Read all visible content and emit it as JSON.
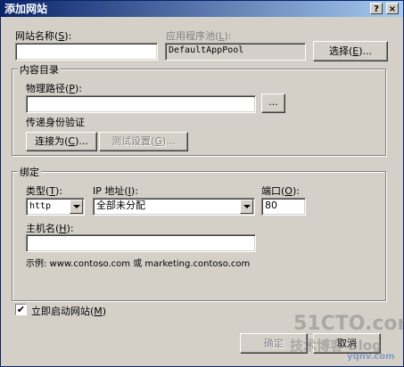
{
  "window": {
    "title": "添加网站",
    "help_label": "?",
    "close_label": "×"
  },
  "site_name": {
    "label": "网站名称",
    "accel": "S",
    "value": ""
  },
  "app_pool": {
    "label": "应用程序池",
    "accel": "L",
    "value": "DefaultAppPool",
    "select_label": "选择",
    "select_accel": "E"
  },
  "content_dir": {
    "legend": "内容目录",
    "physical_path": {
      "label": "物理路径",
      "accel": "P",
      "value": "",
      "browse_label": "..."
    },
    "passthrough_label": "传递身份验证",
    "connect_as": {
      "label": "连接为",
      "accel": "C"
    },
    "test_settings": {
      "label": "测试设置",
      "accel": "G"
    }
  },
  "binding": {
    "legend": "绑定",
    "type": {
      "label": "类型",
      "accel": "T",
      "value": "http"
    },
    "ip": {
      "label": "IP 地址",
      "accel": "I",
      "value": "全部未分配"
    },
    "port": {
      "label": "端口",
      "accel": "O",
      "value": "80"
    },
    "host": {
      "label": "主机名",
      "accel": "H",
      "value": ""
    },
    "example": "示例: www.contoso.com 或 marketing.contoso.com"
  },
  "start_immediately": {
    "label": "立即启动网站",
    "accel": "M",
    "checked": true,
    "check_glyph": "✔"
  },
  "buttons": {
    "ok": "确定",
    "cancel": "取消"
  },
  "watermark": {
    "line1": "51CTO.com",
    "line2": "技术博客 Blog",
    "line3": "yqnv.com"
  },
  "colors": {
    "face": "#d4d0c8",
    "title_start": "#0a246a",
    "title_end": "#a6caf0"
  }
}
